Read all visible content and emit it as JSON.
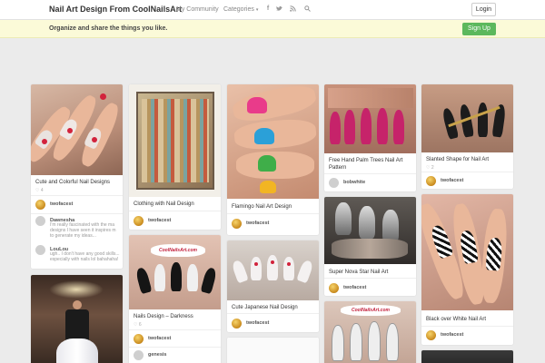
{
  "nav": {
    "brand": "Nail Art Design From CoolNailsArt",
    "community": "My Community",
    "categories": "Categories",
    "login": "Login"
  },
  "banner": {
    "text": "Organize and share the things you like.",
    "signup": "Sign Up"
  },
  "pins": [
    {
      "title": "Cute and Colorful Nail Designs",
      "stat": "♡ 4",
      "user": "twofacest",
      "comments": [
        {
          "user": "Dawnesha",
          "text": "I'm really fascinated with the ma designs I have seen it inspires m to generate my ideas..."
        },
        {
          "user": "LouLou",
          "text": "ugh.. I don't have any good skills... especially with nails lol bahahaha!"
        }
      ]
    },
    {
      "title": "Clothing with Nail Design",
      "user": "twofacest"
    },
    {
      "title": "Flamingo Nail Art Design",
      "user": "twofacest"
    },
    {
      "title": "Free Hand Palm Trees Nail Art Pattern",
      "user": "bobwhite"
    },
    {
      "title": "Slanted Shape for Nail Art",
      "stat": "♡ 2",
      "user": "twofacest"
    },
    {
      "title": "Nails Design – Darkness",
      "stat": "♡ 6",
      "user": "twofacest",
      "comment_user": "genesis"
    },
    {
      "title": "Cute Japanese Nail Design",
      "user": "twofacest"
    },
    {
      "title": "Super Nova Star Nail Art",
      "user": "twofacest"
    },
    {
      "title": "Black over White Nail Art",
      "user": "twofacest"
    }
  ],
  "watermarks": {
    "coolnailsart1": "CoolNailsArt.com",
    "coolnailsart2": "CoolNailsArt.com"
  },
  "colors": {
    "signup": "#5cb85c",
    "banner": "#fbfad8"
  }
}
